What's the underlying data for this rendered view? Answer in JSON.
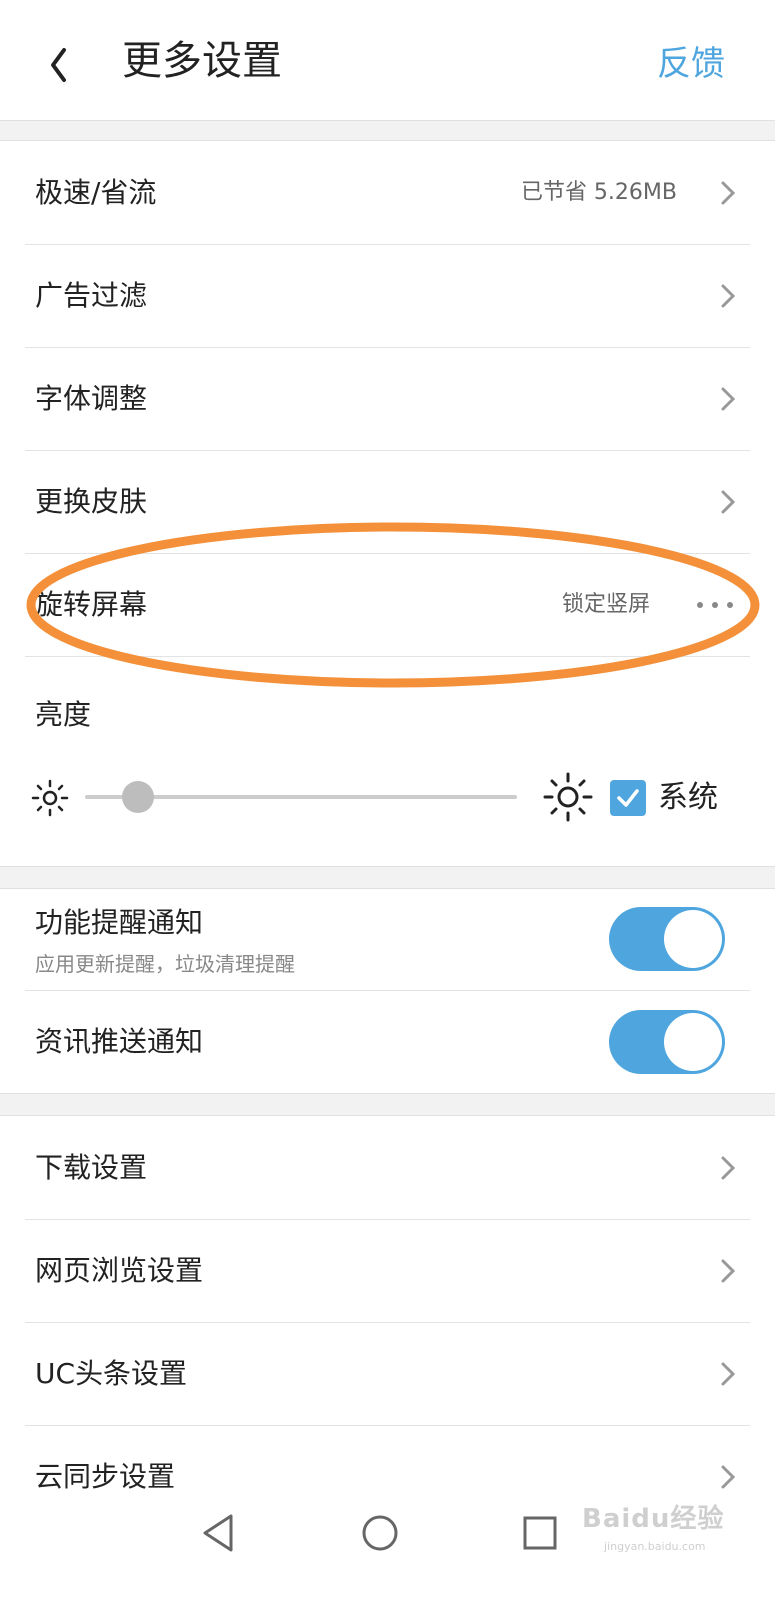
{
  "header": {
    "title": "更多设置",
    "feedback_label": "反馈"
  },
  "section1": {
    "rows": [
      {
        "label": "极速/省流",
        "value": "已节省 5.26MB"
      },
      {
        "label": "广告过滤"
      },
      {
        "label": "字体调整"
      },
      {
        "label": "更换皮肤"
      },
      {
        "label": "旋转屏幕",
        "value": "锁定竖屏"
      }
    ]
  },
  "brightness": {
    "label": "亮度",
    "level": 0.1,
    "system_label": "系统",
    "system_checked": true
  },
  "section2": {
    "rows": [
      {
        "label": "功能提醒通知",
        "sub": "应用更新提醒，垃圾清理提醒",
        "on": true
      },
      {
        "label": "资讯推送通知",
        "on": true
      }
    ]
  },
  "section3": {
    "rows": [
      {
        "label": "下载设置"
      },
      {
        "label": "网页浏览设置"
      },
      {
        "label": "UC头条设置"
      },
      {
        "label": "云同步设置"
      }
    ]
  },
  "watermark": {
    "text": "Baidu经验",
    "sub": "jingyan.baidu.com"
  },
  "colors": {
    "accent": "#4fa6df",
    "highlight": "#f39039"
  },
  "icons": [
    "back-icon",
    "chevron-right-icon",
    "more-dots-icon",
    "sun-small-icon",
    "sun-large-icon",
    "check-icon",
    "nav-back-icon",
    "nav-home-icon",
    "nav-recents-icon"
  ]
}
